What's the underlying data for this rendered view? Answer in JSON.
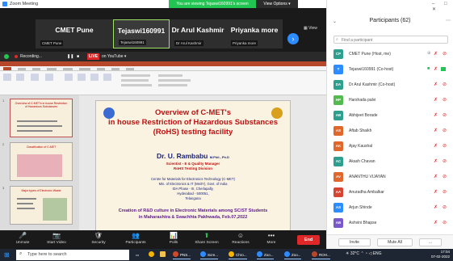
{
  "window": {
    "title": "Zoom Meeting",
    "viewing_banner": "You are viewing Tejaswi160991's screen",
    "view_options": "View Options ▾",
    "view_label": "View"
  },
  "gallery": {
    "tiles": [
      {
        "name": "CMET Pune",
        "sub": "CMET Pune"
      },
      {
        "name": "Tejaswi160991",
        "sub": "Tejaswi160991"
      },
      {
        "name": "Dr Arul Kashmir",
        "sub": "Dr Arul Kashmir"
      },
      {
        "name": "Priyanka more",
        "sub": "Priyanka more"
      }
    ]
  },
  "recording": {
    "label": "Recording...",
    "live_badge": "LIVE",
    "live_target": "on YouTube ▾"
  },
  "slide": {
    "title_line1": "Overview of C-MET's",
    "title_line2": "in house Restriction of Hazardous Substances",
    "title_line3": "(RoHS) testing facility",
    "presenter": "Dr. U. Rambabu",
    "presenter_quals": "M.Phil., Ph.D",
    "role_line1": "Scientist - E & Quality Manager",
    "role_line2": "RoHS Testing Division",
    "address": [
      "Centre for Materials for Electronics Technology (C-MET)",
      "Min. of Electronics & IT (MeitY), Govt. of India",
      "IDA Phase - III, Cherlapally,",
      "Hyderabad - 500051,",
      "Telangana"
    ],
    "footer_line1": "Creation of R&D culture in Electronic Materials among SC/ST Students",
    "footer_line2": "in Maharashtra & Swachhta Pakhwada, Feb.07,2022"
  },
  "thumbnails": [
    {
      "num": "1",
      "title": "Overview of C-MET's in house Restriction of Hazardous Substances"
    },
    {
      "num": "2",
      "title": "Classification of C-MET"
    },
    {
      "num": "3",
      "title": "Major types of Electronic Waste"
    }
  ],
  "controls": [
    {
      "label": "Unmute",
      "icon": "🎤"
    },
    {
      "label": "Start Video",
      "icon": "📷"
    },
    {
      "label": "Security",
      "icon": "🛡"
    },
    {
      "label": "Participants",
      "icon": "👥"
    },
    {
      "label": "Polls",
      "icon": "📊"
    },
    {
      "label": "Share Screen",
      "icon": "⬆"
    },
    {
      "label": "Reactions",
      "icon": "☺"
    },
    {
      "label": "More",
      "icon": "•••"
    }
  ],
  "end_button": "End",
  "participants": {
    "title": "Participants (62)",
    "search_placeholder": "Find a participant",
    "list": [
      {
        "initials": "CP",
        "name": "CMET Pune (Host, me)",
        "color": "#2e9e8f"
      },
      {
        "initials": "T",
        "name": "Tejaswi160991 (Co-host)",
        "color": "#2d8cff"
      },
      {
        "initials": "DA",
        "name": "Dr Arul Kashmir (Co-host)",
        "color": "#2e9e8f"
      },
      {
        "initials": "HP",
        "name": "Harshada palvi",
        "color": "#54b94e"
      },
      {
        "initials": "AB",
        "name": "Abhijeet Borade",
        "color": "#2e9e8f"
      },
      {
        "initials": "AS",
        "name": "Aftab Shaikh",
        "color": "#e0672b"
      },
      {
        "initials": "AK",
        "name": "Ajay Kaushal",
        "color": "#e0672b"
      },
      {
        "initials": "AC",
        "name": "Akash Chavan",
        "color": "#2e9e8f"
      },
      {
        "initials": "AV",
        "name": "ANANTHU VIJAYAN",
        "color": "#e0672b"
      },
      {
        "initials": "AA",
        "name": "Anuradha Ambalkar",
        "color": "#d64531"
      },
      {
        "initials": "AS",
        "name": "Arjun Shinde",
        "color": "#2d8cff"
      },
      {
        "initials": "AB",
        "name": "Ashvini Bhapse",
        "color": "#7b58c9"
      }
    ],
    "invite": "Invite",
    "mute_all": "Mute All",
    "more": "..."
  },
  "taskbar": {
    "search_placeholder": "Type here to search",
    "apps": [
      {
        "label": "PNS...",
        "color": "#d04a2a"
      },
      {
        "label": "Scre...",
        "color": "#2d8cff"
      },
      {
        "label": "Chro...",
        "color": "#f4b400"
      },
      {
        "label": "Zoo...",
        "color": "#2d8cff"
      },
      {
        "label": "Zoo...",
        "color": "#2d8cff"
      },
      {
        "label": "ROH...",
        "color": "#b7472a"
      }
    ],
    "weather": "32°C",
    "language": "ENG",
    "time": "17:04",
    "date": "07-02-2022"
  }
}
